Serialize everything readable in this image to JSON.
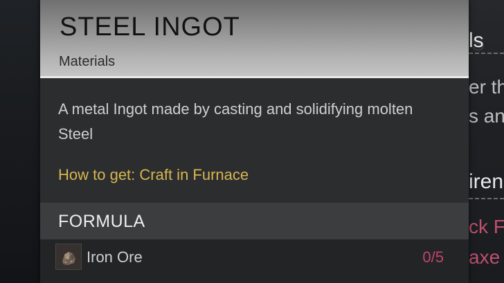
{
  "item": {
    "title": "STEEL INGOT",
    "category": "Materials",
    "description": "A metal Ingot made by casting and solidifying molten Steel",
    "how_to_get": "How to get: Craft in Furnace"
  },
  "formula": {
    "title": "FORMULA",
    "ingredients": [
      {
        "name": "Iron Ore",
        "count": "0/5",
        "icon": "iron-ore-icon"
      }
    ]
  },
  "background": {
    "ghost_heading": "Details",
    "frag_heading": "ls",
    "frag_line1": "er th",
    "frag_line2": "s and",
    "frag_requirements": "iren",
    "frag_link1": "ck F",
    "frag_link2": "axe"
  },
  "colors": {
    "how_to_get": "#d7b650",
    "count_insufficient": "#c2456a",
    "link": "#c0506e"
  }
}
